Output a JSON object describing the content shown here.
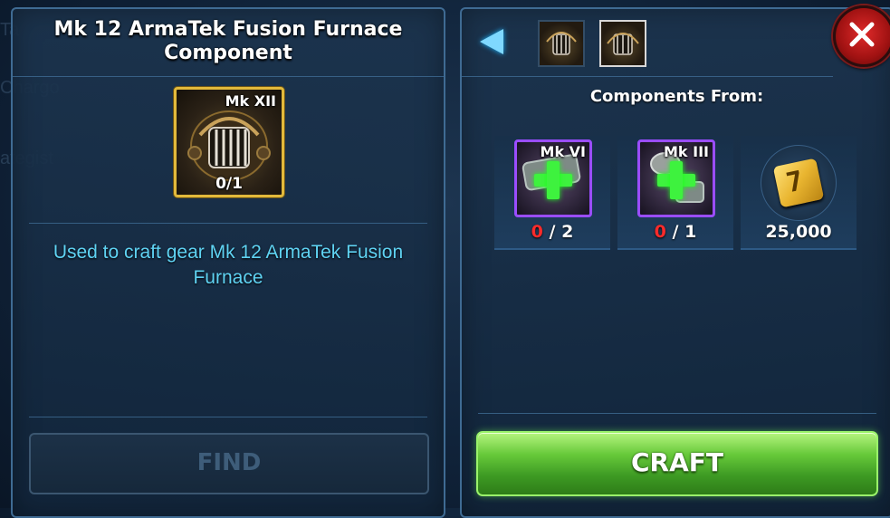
{
  "background": {
    "faded_labels": [
      "Ta",
      "Chargo",
      "ategist"
    ]
  },
  "left_panel": {
    "title": "Mk 12 ArmaTek Fusion Furnace Component",
    "gear": {
      "mark": "Mk XII",
      "count": "0/1",
      "border_color": "#e2b93b"
    },
    "description": "Used to craft gear Mk 12 ArmaTek Fusion Furnace",
    "find_label": "FIND"
  },
  "right_panel": {
    "back_icon": "back-arrow-icon",
    "close_icon": "close-icon",
    "heading": "Components From:",
    "components": [
      {
        "mark": "Mk VI",
        "have": "0",
        "need": "/ 2",
        "tier_color": "#9a4dff"
      },
      {
        "mark": "Mk III",
        "have": "0",
        "need": "/ 1",
        "tier_color": "#9a4dff"
      }
    ],
    "credits": {
      "icon": "credits-icon",
      "amount": "25,000"
    },
    "craft_label": "CRAFT"
  }
}
